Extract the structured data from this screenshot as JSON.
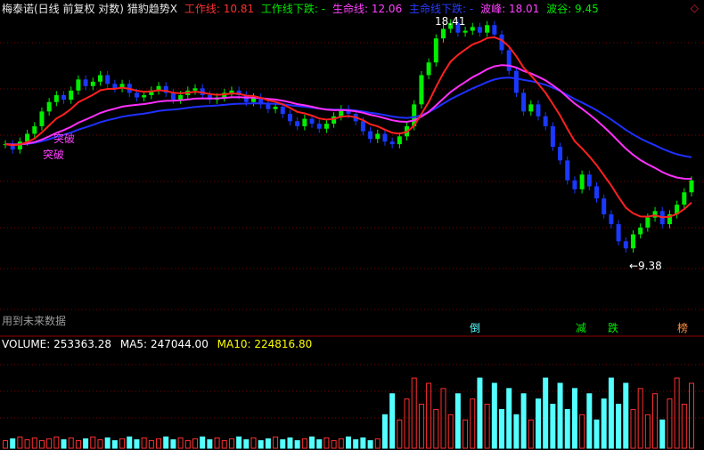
{
  "header": {
    "title": "梅泰诺(日线 前复权 对数) 猎豹趋势X",
    "items": [
      {
        "label": "工作线:",
        "value": "10.81",
        "color": "#ff3030"
      },
      {
        "label": "工作线下跌:",
        "value": "-",
        "color": "#00e800"
      },
      {
        "label": "生命线:",
        "value": "12.06",
        "color": "#ff40ff"
      },
      {
        "label": "主命线下跌:",
        "value": "-",
        "color": "#2a3cff"
      },
      {
        "label": "波峰:",
        "value": "18.01",
        "color": "#ff40ff"
      },
      {
        "label": "波谷:",
        "value": "9.45",
        "color": "#00e800"
      }
    ],
    "corner_icon": "diamond-icon"
  },
  "note": "用到未来数据",
  "volume_header": {
    "items": [
      {
        "label": "VOLUME:",
        "value": "253363.28",
        "color": "#ffffff"
      },
      {
        "label": "MA5:",
        "value": "247044.00",
        "color": "#ffffff"
      },
      {
        "label": "MA10:",
        "value": "224816.80",
        "color": "#ffff00"
      }
    ]
  },
  "colors": {
    "up": "#ff3030",
    "down": "#54ffff",
    "bull_candle": "#00ee00",
    "bear_candle": "#1a39ff",
    "work_line": "#ff2020",
    "work_line_down": "#00e800",
    "life_line": "#ff30ff",
    "main_line_down": "#2030ff",
    "ma5": "#ffffff",
    "ma10": "#ffff00",
    "grid": "#7a0000"
  },
  "chart_data": {
    "type": "candlestick",
    "log_scale": true,
    "annotations": {
      "breakout_labels": [
        "突破",
        "突破"
      ],
      "peak_label": "18.41",
      "trough_label": "9.38",
      "event_markers": [
        "倒",
        "减",
        "跌",
        "榜"
      ]
    },
    "price_reference": {
      "peak": 18.41,
      "trough": 9.38
    }
  }
}
